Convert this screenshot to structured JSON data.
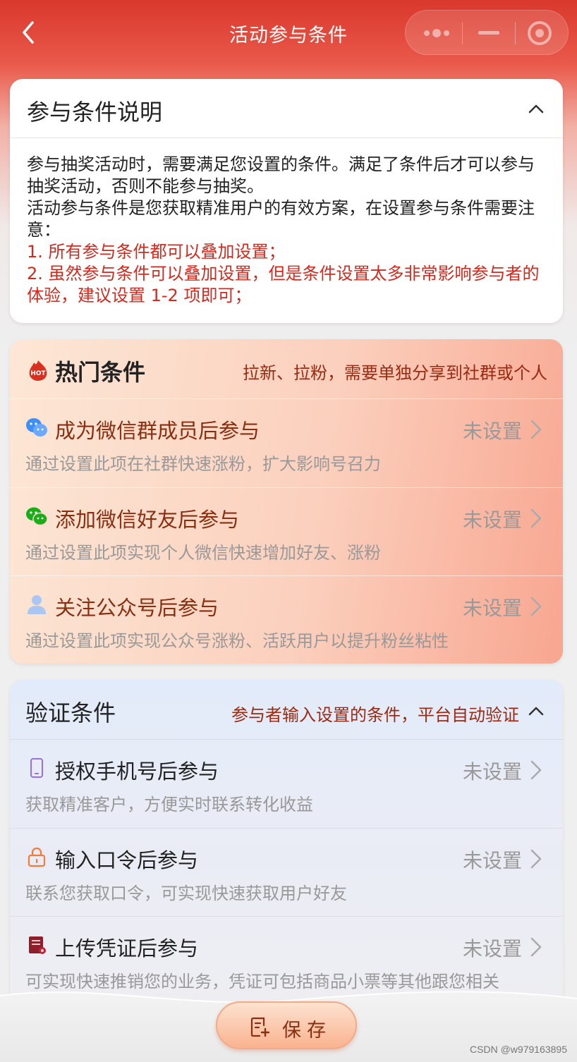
{
  "nav": {
    "title": "活动参与条件"
  },
  "intro": {
    "title": "参与条件说明",
    "paragraphs": [
      "参与抽奖活动时，需要满足您设置的条件。满足了条件后才可以参与抽奖活动，否则不能参与抽奖。",
      "活动参与条件是您获取精准用户的有效方案，在设置参与条件需要注意："
    ],
    "notes": [
      "1. 所有参与条件都可以叠加设置；",
      "2. 虽然参与条件可以叠加设置，但是条件设置太多非常影响参与者的体验，建议设置 1-2 项即可；"
    ]
  },
  "hot": {
    "icon_text": "HOT",
    "title": "热门条件",
    "subtitle": "拉新、拉粉，需要单独分享到社群或个人",
    "items": [
      {
        "icon": "wechat-group-icon",
        "title": "成为微信群成员后参与",
        "desc": "通过设置此项在社群快速涨粉，扩大影响号召力",
        "status": "未设置"
      },
      {
        "icon": "wechat-icon",
        "title": "添加微信好友后参与",
        "desc": "通过设置此项实现个人微信快速增加好友、涨粉",
        "status": "未设置"
      },
      {
        "icon": "person-icon",
        "title": "关注公众号后参与",
        "desc": "通过设置此项实现公众号涨粉、活跃用户以提升粉丝粘性",
        "status": "未设置"
      }
    ]
  },
  "verify": {
    "title": "验证条件",
    "subtitle": "参与者输入设置的条件，平台自动验证",
    "items": [
      {
        "icon": "phone-icon",
        "title": "授权手机号后参与",
        "desc": "获取精准客户，方便实时联系转化收益",
        "status": "未设置"
      },
      {
        "icon": "lock-icon",
        "title": "输入口令后参与",
        "desc": "联系您获取口令，可实现快速获取用户好友",
        "status": "未设置"
      },
      {
        "icon": "certificate-icon",
        "title": "上传凭证后参与",
        "desc": "可实现快速推销您的业务，凭证可包括商品小票等其他跟您相关",
        "status": "未设置"
      }
    ]
  },
  "footer": {
    "save_label": "保存",
    "watermark": "CSDN @w979163895"
  },
  "colors": {
    "header_red": "#d9382c",
    "accent_red": "#d22a1e",
    "hot_title": "#8a2e10"
  }
}
